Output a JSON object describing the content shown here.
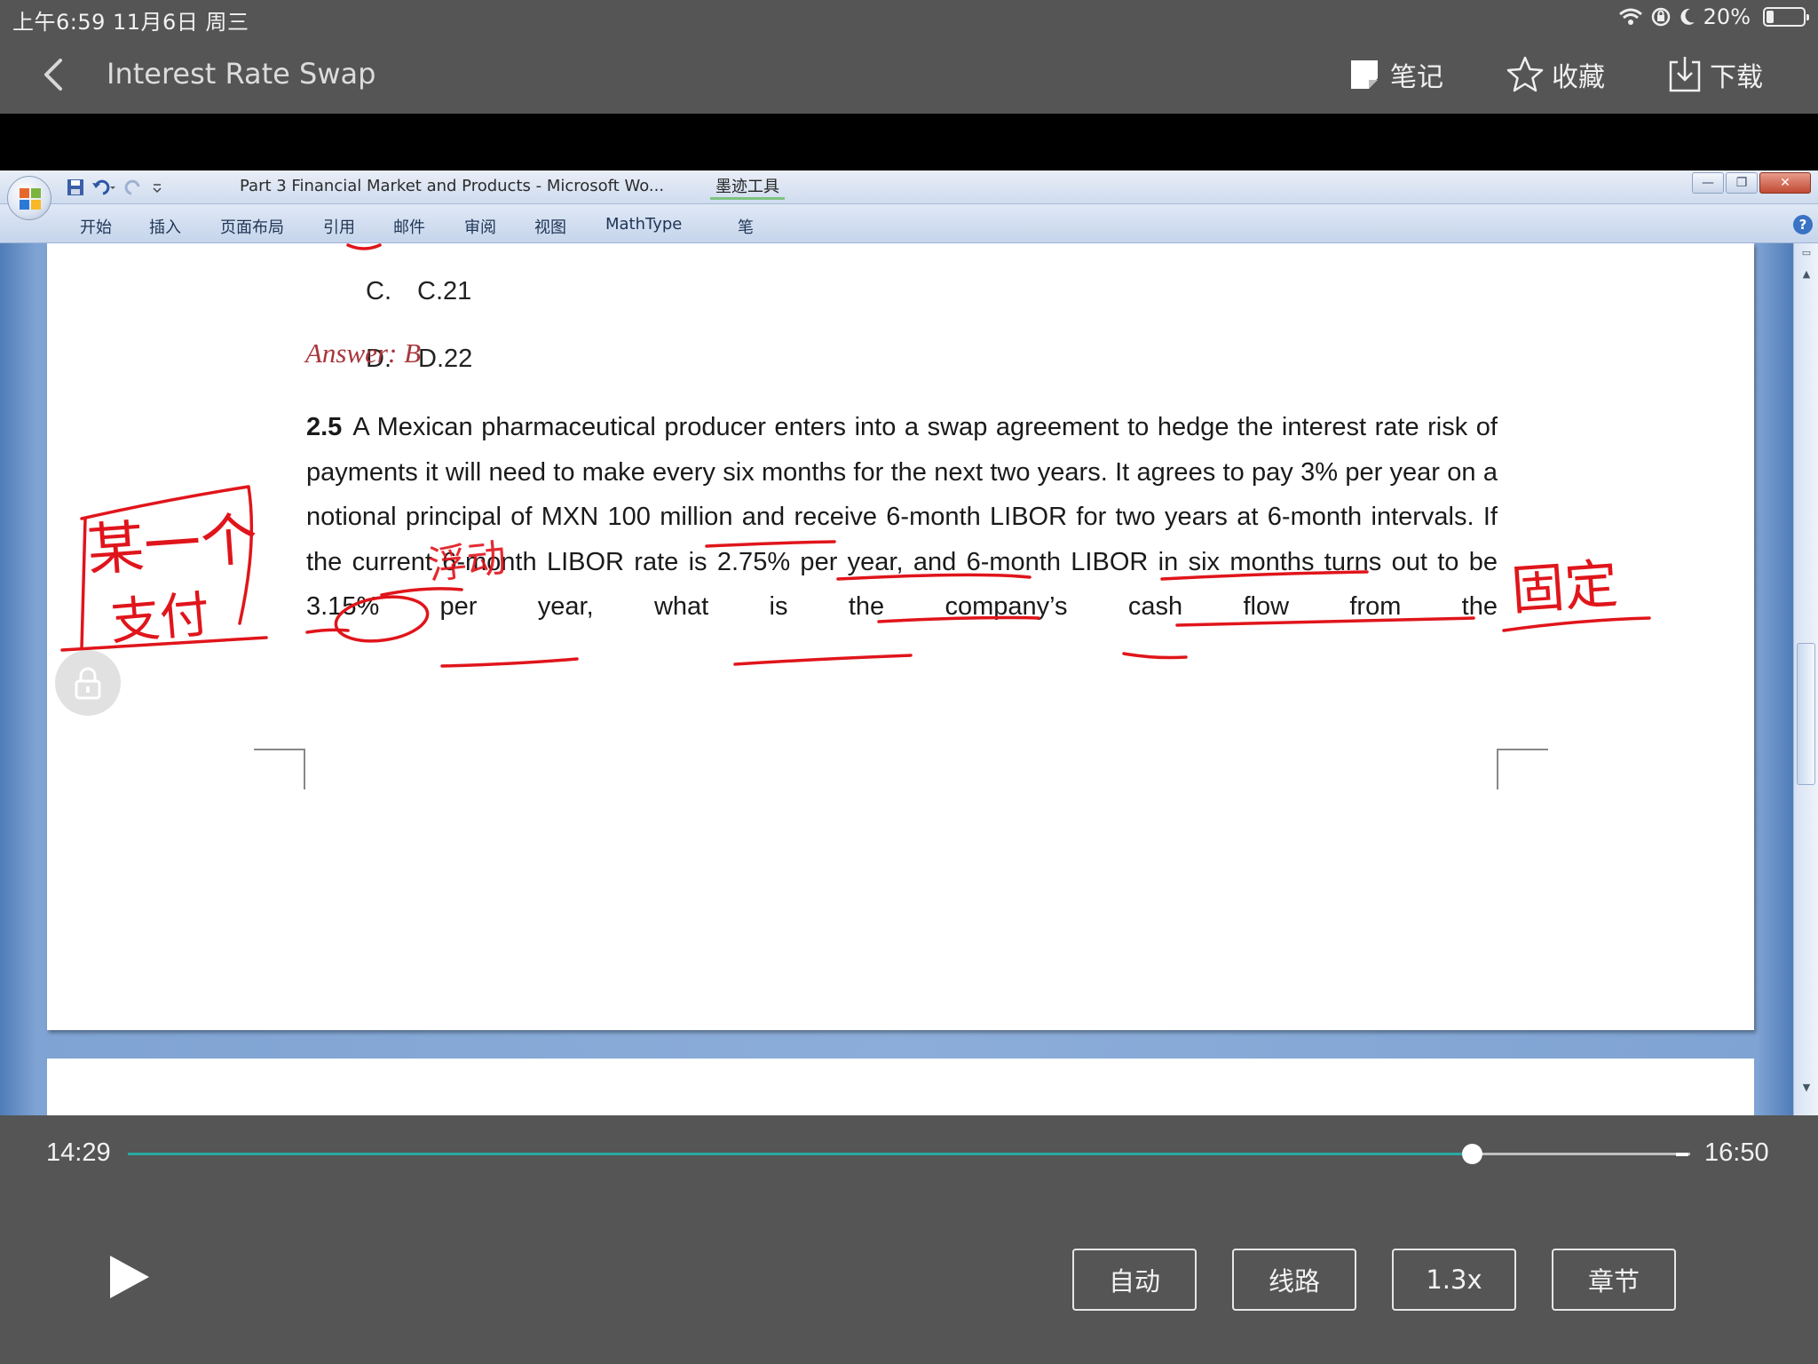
{
  "status_bar": {
    "time_date": "上午6:59   11月6日 周三",
    "battery_text": "20%",
    "battery_level": 0.2
  },
  "nav": {
    "title": "Interest Rate Swap",
    "notes_label": "笔记",
    "favorite_label": "收藏",
    "download_label": "下载"
  },
  "word": {
    "doc_title": "Part 3 Financial Market and Products  -  Microsoft Wo...",
    "ink_tools_label": "墨迹工具",
    "tabs": [
      "开始",
      "插入",
      "页面布局",
      "引用",
      "邮件",
      "审阅",
      "视图",
      "MathType",
      "笔"
    ]
  },
  "document": {
    "option_c_letter": "C.",
    "option_c_text": "C.21",
    "option_d_letter": "D.",
    "option_d_text": "D.22",
    "answer": "Answer: B",
    "question_number": "2.5",
    "question_text": "A Mexican pharmaceutical producer enters into a swap agreement to hedge the interest rate risk of payments it will need to make every six months for the next two years. It agrees to pay 3% per year on a notional principal of MXN 100 million and receive 6-month LIBOR for two years at 6-month intervals. If the current 6-month LIBOR rate is 2.75% per year, and 6-month LIBOR in six months turns out to be 3.15% per year, what is the company’s cash flow from the"
  },
  "annotations": {
    "box_text_line1": "某一个",
    "box_text_line2": "支付",
    "payment_note": "浮动",
    "right_note": "固定",
    "ink_color": "#e0151b"
  },
  "player": {
    "current_time": "14:29",
    "total_time": "16:50",
    "progress": 0.86,
    "accent_color": "#27a9a0",
    "buttons": {
      "auto": "自动",
      "route": "线路",
      "speed": "1.3x",
      "chapters": "章节"
    }
  }
}
